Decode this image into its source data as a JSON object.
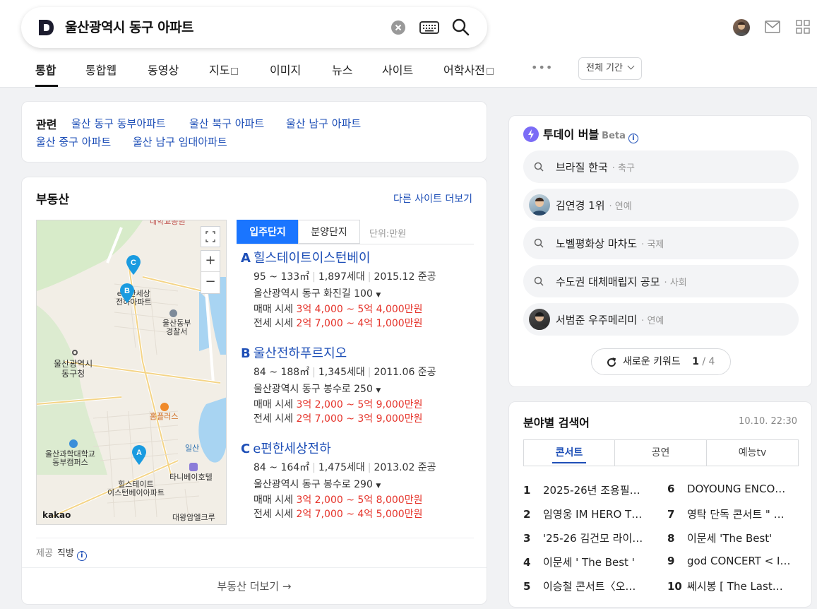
{
  "search": {
    "query": "울산광역시 동구 아파트"
  },
  "tabs": [
    {
      "label": "통합",
      "active": true
    },
    {
      "label": "통합웹"
    },
    {
      "label": "동영상"
    },
    {
      "label": "지도",
      "external": true
    },
    {
      "label": "이미지"
    },
    {
      "label": "뉴스"
    },
    {
      "label": "사이트"
    },
    {
      "label": "어학사전",
      "external": true
    }
  ],
  "more_label": "•••",
  "period_label": "전체 기간",
  "related": {
    "label": "관련",
    "links": [
      "울산 동구 동부아파트",
      "울산 북구 아파트",
      "울산 남구 아파트",
      "울산 중구 아파트",
      "울산 남구 임대아파트"
    ]
  },
  "realestate": {
    "title": "부동산",
    "more_sites": "다른 사이트 더보기",
    "seg_resident": "입주단지",
    "seg_sale": "분양단지",
    "unit": "단위:만원",
    "map": {
      "labels": {
        "top": "대학교공원",
        "b_name": "e편한세상\n전하아파트",
        "police": "울산동부\n경찰서",
        "office": "울산광역시\n동구청",
        "homeplus": "홈플러스",
        "college": "울산과학대학교\n동부캠퍼스",
        "a_name": "힐스테이트\n이스턴베이아파트",
        "ilsan": "일산",
        "hotel": "타니베이호텔",
        "daewang": "대왕암엘크루"
      },
      "brand": "kakao"
    },
    "apartments": [
      {
        "marker": "A",
        "name": "힐스테이트이스턴베이",
        "area": "95 ~ 133㎡",
        "households": "1,897세대",
        "completed": "2015.12 준공",
        "address": "울산광역시 동구 화진길 100",
        "sale_label": "매매 시세",
        "sale_price": "3억 4,000 ~ 5억 4,000만원",
        "jeonse_label": "전세 시세",
        "jeonse_price": "2억 7,000 ~ 4억 1,000만원"
      },
      {
        "marker": "B",
        "name": "울산전하푸르지오",
        "area": "84 ~ 188㎡",
        "households": "1,345세대",
        "completed": "2011.06 준공",
        "address": "울산광역시 동구 봉수로 250",
        "sale_label": "매매 시세",
        "sale_price": "3억 2,000 ~ 5억 9,000만원",
        "jeonse_label": "전세 시세",
        "jeonse_price": "2억 7,000 ~ 3억 9,000만원"
      },
      {
        "marker": "C",
        "name": "e편한세상전하",
        "area": "84 ~ 164㎡",
        "households": "1,475세대",
        "completed": "2013.02 준공",
        "address": "울산광역시 동구 봉수로 290",
        "sale_label": "매매 시세",
        "sale_price": "3억 2,000 ~ 5억 8,000만원",
        "jeonse_label": "전세 시세",
        "jeonse_price": "2억 7,000 ~ 4억 5,000만원"
      }
    ],
    "provider_label": "제공",
    "provider_name": "직방",
    "more": "부동산 더보기"
  },
  "bubble": {
    "title": "투데이 버블",
    "beta": "Beta",
    "items": [
      {
        "text": "브라질 한국",
        "category": "축구",
        "icon": "search-icon"
      },
      {
        "text": "김연경 1위",
        "category": "연예",
        "icon": "person-avatar"
      },
      {
        "text": "노벨평화상 마차도",
        "category": "국제",
        "icon": "search-icon"
      },
      {
        "text": "수도권 대체매립지 공모",
        "category": "사회",
        "icon": "search-icon"
      },
      {
        "text": "서범준 우주메리미",
        "category": "연예",
        "icon": "person-avatar"
      }
    ],
    "new_keywords": "새로운 키워드",
    "page_current": "1",
    "page_total": "/ 4"
  },
  "field": {
    "title": "분야별 검색어",
    "time": "10.10. 22:30",
    "tabs": [
      "콘서트",
      "공연",
      "예능tv"
    ],
    "ranks": [
      {
        "n": "1",
        "text": "2025-26년 조용필＆…"
      },
      {
        "n": "2",
        "text": "임영웅 IM HERO T…"
      },
      {
        "n": "3",
        "text": "'25-26 김건모 라이…"
      },
      {
        "n": "4",
        "text": "이문세 ' The Best '"
      },
      {
        "n": "5",
        "text": "이승철 콘서트〈오…"
      },
      {
        "n": "6",
        "text": "DOYOUNG ENCO…"
      },
      {
        "n": "7",
        "text": "영탁 단독 콘서트 \" …"
      },
      {
        "n": "8",
        "text": "이문세 'The Best'"
      },
      {
        "n": "9",
        "text": "god CONCERT < IC…"
      },
      {
        "n": "10",
        "text": "쎄시봉 [ The Last…"
      }
    ]
  },
  "colors": {
    "link": "#1e4fb7",
    "price": "#e5332a",
    "accent": "#1a75ff"
  }
}
